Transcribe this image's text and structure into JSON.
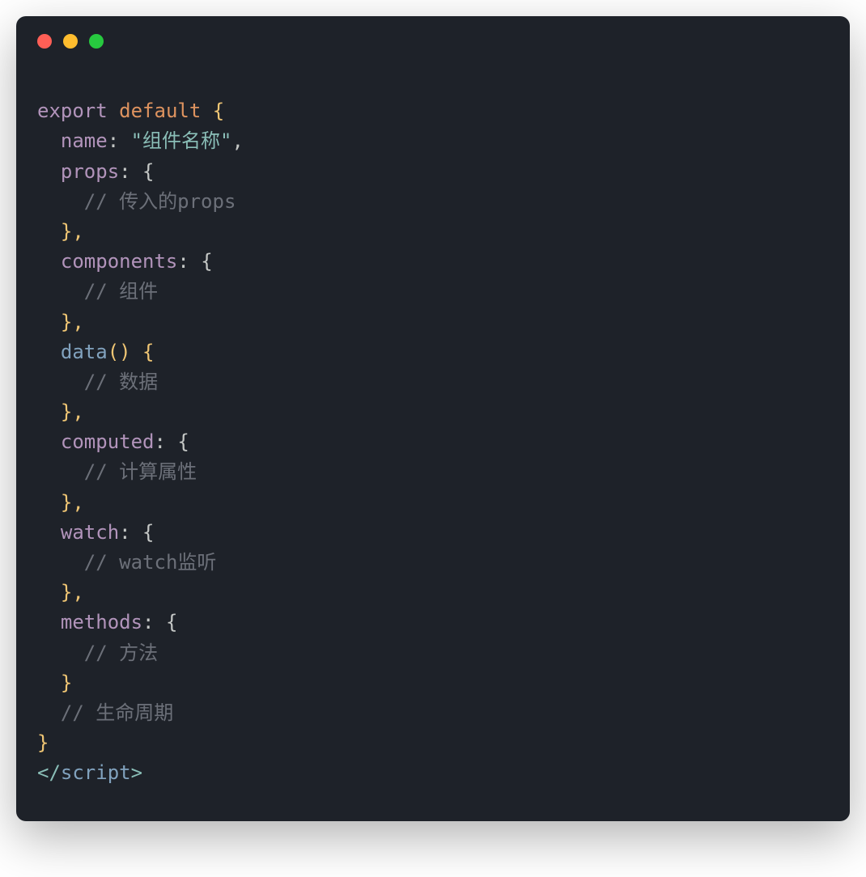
{
  "window": {
    "dots": [
      "red",
      "yellow",
      "green"
    ]
  },
  "code": {
    "line1_export": "export",
    "line1_default": "default",
    "line1_brace": " {",
    "line2_prop": "name",
    "line2_colon": ": ",
    "line2_string": "\"组件名称\"",
    "line2_comma": ",",
    "line3_prop": "props",
    "line3_rest": ": {",
    "line4_comment": "// 传入的props",
    "line5": "},",
    "line6_prop": "components",
    "line6_rest": ": {",
    "line7_comment": "// 组件",
    "line8": "},",
    "line9_method": "data",
    "line9_parens": "()",
    "line9_brace": " {",
    "line10_comment": "// 数据",
    "line11": "},",
    "line12_prop": "computed",
    "line12_rest": ": {",
    "line13_comment": "// 计算属性",
    "line14": "},",
    "line15_prop": "watch",
    "line15_rest": ": {",
    "line16_comment": "// watch监听",
    "line17": "},",
    "line18_prop": "methods",
    "line18_rest": ": {",
    "line19_comment": "// 方法",
    "line20": "}",
    "line21_comment": "// 生命周期",
    "line22": "}",
    "line23_open": "</",
    "line23_tag": "script",
    "line23_close": ">"
  }
}
